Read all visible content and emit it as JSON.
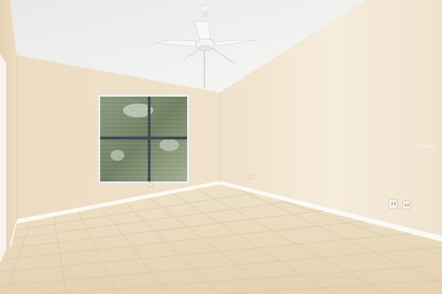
{
  "scene": {
    "description_free": true,
    "watermark_text": "Stellar",
    "colors": {
      "ceiling": "#f1f1ef",
      "left_wall": "#eedfc6",
      "back_wall": "#efe2ca",
      "right_wall": "#f3e8d6",
      "floor": "#eadcbf",
      "tile_grout": "#d9c7a6",
      "baseboard": "#fbfaf7",
      "window_frame": "#f4f4f4",
      "fan": "#f7f7f7"
    },
    "icons": [
      "ceiling-fan-icon",
      "window-icon",
      "outlet-icon"
    ]
  }
}
